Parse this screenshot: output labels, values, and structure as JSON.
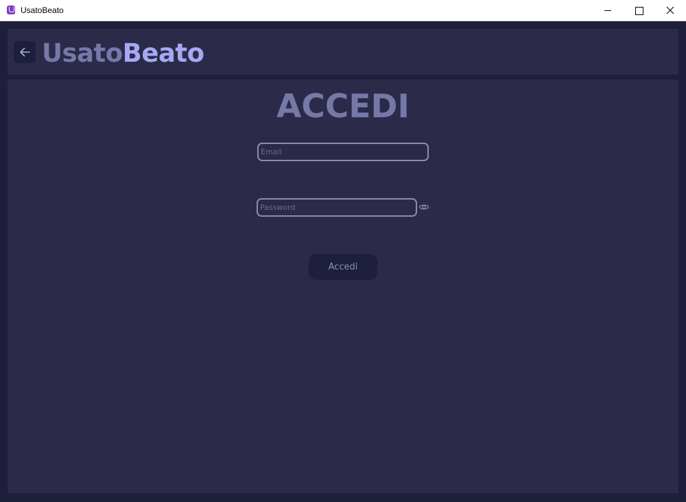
{
  "window": {
    "title": "UsatoBeato",
    "icon": "app-icon"
  },
  "header": {
    "logo_part1": "Usato",
    "logo_part2": "Beato",
    "back_icon": "arrow-left-icon"
  },
  "login": {
    "title": "ACCEDI",
    "email_placeholder": "Email",
    "password_placeholder": "Password",
    "submit_label": "Accedi",
    "toggle_icon": "eye-icon"
  },
  "colors": {
    "frame_bg": "#1e1f3b",
    "panel_bg": "#2b2b49",
    "logo_muted": "#7678a8",
    "logo_accent": "#a6a8f2",
    "input_border": "#8d8ea8"
  }
}
